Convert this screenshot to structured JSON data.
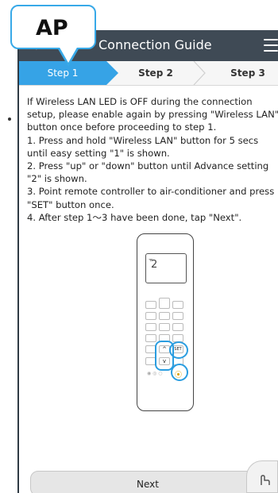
{
  "callout": {
    "label": "AP",
    "accent": "#38a9e8"
  },
  "header": {
    "title": "Connection Guide",
    "back_icon": "chevron-left-icon",
    "menu_icon": "hamburger-menu-icon",
    "bg": "#3f4a55"
  },
  "steps": [
    {
      "label": "Step 1",
      "active": true
    },
    {
      "label": "Step 2",
      "active": false
    },
    {
      "label": "Step 3",
      "active": false
    }
  ],
  "instructions": [
    "If Wireless LAN LED is OFF during the connection setup, please enable again by pressing \"Wireless LAN\" button once before proceeding to step 1.",
    "1. Press and hold \"Wireless LAN\" button for 5 secs until easy setting \"1\" is shown.",
    "2. Press \"up\" or \"down\" button until Advance setting \"2\" is shown.",
    "3. Point remote controller to air-conditioner and press \"SET\" button once.",
    "4. After step 1～3 have been done, tap \"Next\"."
  ],
  "remote": {
    "display_value": "2",
    "set_label": "SET"
  },
  "footer": {
    "next_label": "Next"
  },
  "colors": {
    "step_active": "#36a3e6",
    "highlight_ring": "#2a9de0"
  }
}
